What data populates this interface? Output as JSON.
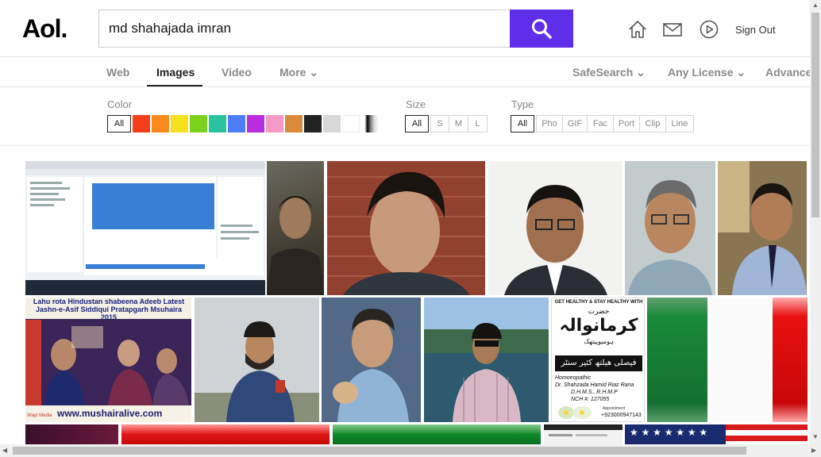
{
  "header": {
    "logo": "Aol.",
    "search_value": "md shahajada imran",
    "signout_label": "Sign Out"
  },
  "tabs": {
    "web": "Web",
    "images": "Images",
    "video": "Video",
    "more": "More ⌄",
    "safesearch": "SafeSearch ⌄",
    "license": "Any License ⌄",
    "advanced": "Advanced"
  },
  "filters": {
    "color_label": "Color",
    "color_all": "All",
    "colors": [
      "#f4401a",
      "#fa8a1e",
      "#f7e01c",
      "#7cd21c",
      "#2ac3a2",
      "#4f7df6",
      "#b92fe0",
      "#f59ac6",
      "#d98a3a",
      "#222222",
      "#d8d8d8",
      "#ffffff"
    ],
    "size_label": "Size",
    "sizes": [
      "All",
      "S",
      "M",
      "L"
    ],
    "type_label": "Type",
    "types": [
      "All",
      "Pho",
      "GIF",
      "Fac",
      "Port",
      "Clip",
      "Line"
    ]
  },
  "results": {
    "poster1_title": "Lahu rota Hindustan shabeena Adeeb Latest Jashn-e-Asif Siddiqui Pratapgarh Msuhaira 2015",
    "poster1_url": "www.mushairalive.com",
    "poster1_badge": "Wayt Media",
    "poster2_header": "GET HEALTHY & STAY HEALTHY WITH",
    "poster2_urdu1": "حضرت",
    "poster2_urdu2": "کرمانوالہ",
    "poster2_urdu3": "ہومیوپیتھک",
    "poster2_urdu4": "فیصلی ھیلتھ کئیر سنٹر",
    "poster2_line1": "Homoeopathic",
    "poster2_line2": "Dr. Shahzada Hamid Riaz Rana",
    "poster2_line3": "D.H.M.S., R.H.M.P",
    "poster2_line4": "NCH #: 127055",
    "poster2_line5": "Appointment",
    "poster2_phone": "+923000947143"
  }
}
